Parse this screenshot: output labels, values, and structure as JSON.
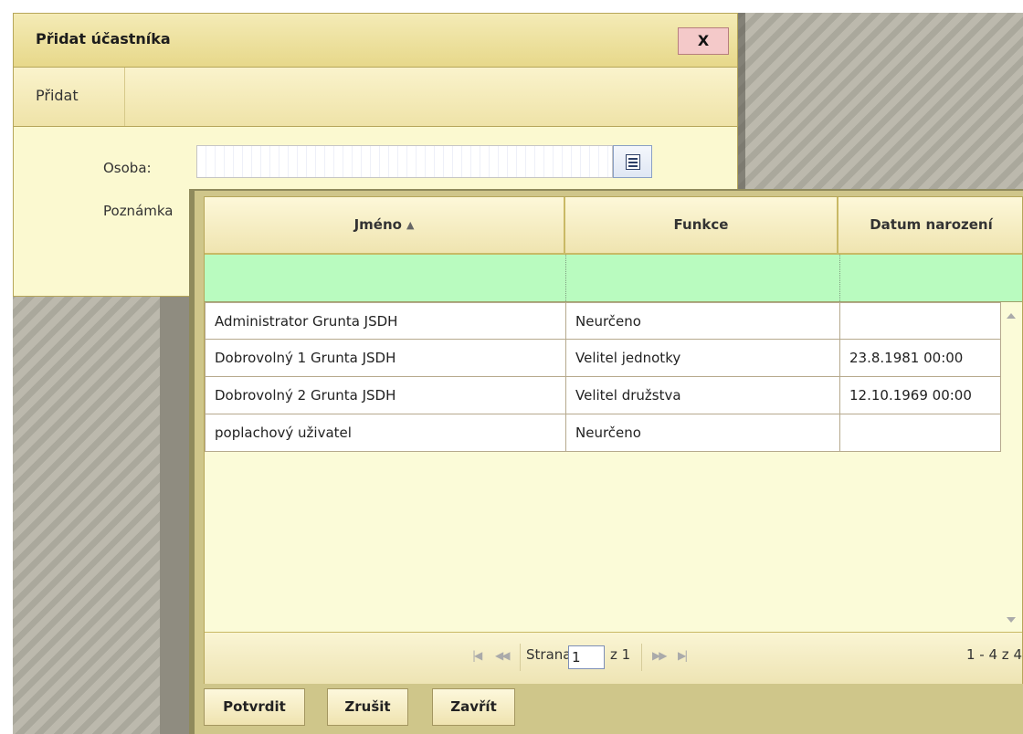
{
  "dialog": {
    "title": "Přidat účastníka",
    "close_label": "X",
    "toolbar": {
      "tab_label": "Přidat"
    },
    "form": {
      "osoba_label": "Osoba:",
      "osoba_value": "",
      "poznamka_label": "Poznámka"
    }
  },
  "grid": {
    "columns": [
      {
        "label": "Jméno",
        "sorted": true
      },
      {
        "label": "Funkce"
      },
      {
        "label": "Datum narození"
      }
    ],
    "rows": [
      {
        "name": "Administrator Grunta JSDH",
        "function": "Neurčeno",
        "birthdate": ""
      },
      {
        "name": "Dobrovolný 1 Grunta JSDH",
        "function": "Velitel jednotky",
        "birthdate": "23.8.1981 00:00"
      },
      {
        "name": "Dobrovolný 2 Grunta JSDH",
        "function": "Velitel družstva",
        "birthdate": "12.10.1969 00:00"
      },
      {
        "name": "poplachový uživatel",
        "function": "Neurčeno",
        "birthdate": ""
      }
    ],
    "pager": {
      "page_label": "Strana",
      "page_value": "1",
      "page_of": "z 1",
      "summary": "1 - 4 z 4"
    }
  },
  "buttons": {
    "confirm": "Potvrdit",
    "cancel": "Zrušit",
    "close": "Zavřít"
  },
  "colors": {
    "header": "#e7d88a",
    "filter_row": "#b9fbbf",
    "close_button": "#f4c9c9"
  }
}
